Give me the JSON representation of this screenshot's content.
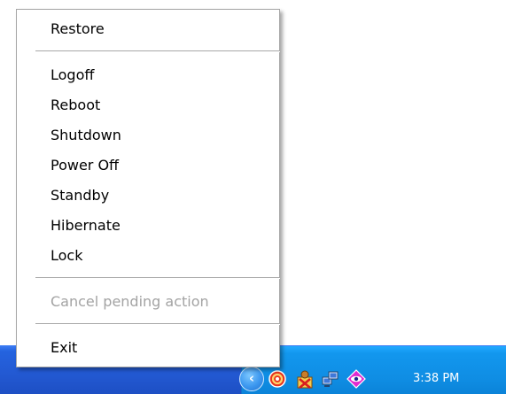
{
  "menu": {
    "restore_label": "Restore",
    "session_items": [
      {
        "label": "Logoff"
      },
      {
        "label": "Reboot"
      },
      {
        "label": "Shutdown"
      },
      {
        "label": "Power Off"
      },
      {
        "label": "Standby"
      },
      {
        "label": "Hibernate"
      },
      {
        "label": "Lock"
      }
    ],
    "cancel_label": "Cancel pending action",
    "cancel_enabled": false,
    "exit_label": "Exit"
  },
  "taskbar": {
    "chevron_icon": "chevron-left-icon",
    "tray_icons": [
      "red-circle-power-icon",
      "user-blocked-icon",
      "network-computers-icon",
      "diamond-eye-icon"
    ],
    "clock": "3:38 PM",
    "colors": {
      "taskbar": "#2359d2",
      "tray": "#0f8de3"
    }
  }
}
